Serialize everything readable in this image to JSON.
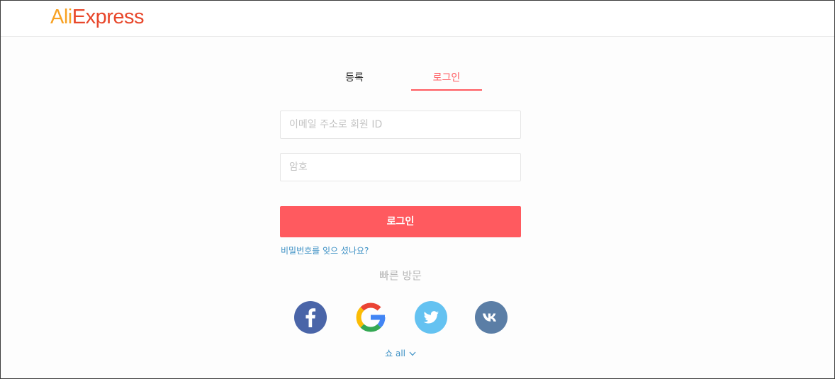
{
  "header": {
    "logo_part1": "Ali",
    "logo_part2": "Express"
  },
  "tabs": {
    "register": "등록",
    "login": "로그인"
  },
  "form": {
    "email_placeholder": "이메일 주소로 회원 ID",
    "password_placeholder": "암호",
    "login_button": "로그인",
    "forgot_password": "비밀번호를 잊으 셨나요?"
  },
  "quick_login": {
    "title": "빠른 방문",
    "show_all": "쇼 all",
    "providers": [
      "facebook-icon",
      "google-icon",
      "twitter-icon",
      "vk-icon"
    ]
  },
  "colors": {
    "accent": "#ff5a5f",
    "link": "#3a8fc4",
    "facebook": "#4a65a8",
    "twitter": "#64c2f1",
    "vk": "#5b7ea6",
    "logo_ali": "#f7a224",
    "logo_express": "#e8472b"
  }
}
